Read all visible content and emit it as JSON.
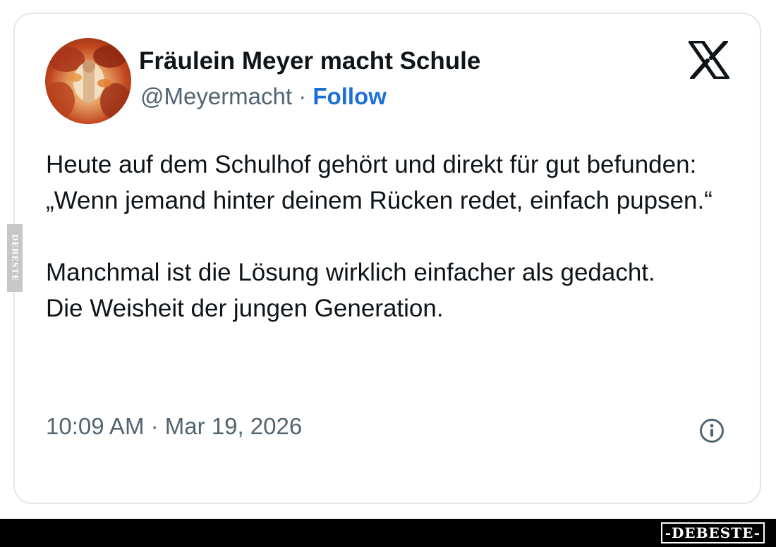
{
  "tweet": {
    "author": {
      "name": "Fräulein Meyer macht Schule",
      "handle": "@Meyermacht",
      "separator": " · ",
      "follow_label": "Follow",
      "avatar_icon": "avatar-photo-autumn-leaves"
    },
    "brand_icon": "x-logo-icon",
    "text_lines": [
      "Heute auf dem Schulhof gehört und direkt für gut befunden:",
      "„Wenn jemand hinter deinem Rücken redet, einfach pupsen.“",
      "",
      "Manchmal ist die Lösung wirklich einfacher als gedacht.",
      "Die Weisheit der jungen Generation."
    ],
    "timestamp": "10:09 AM · Mar 19, 2026",
    "info_icon": "info-icon"
  },
  "watermark": {
    "side": "DEBESTE",
    "bottom": "-DEBESTE-"
  },
  "colors": {
    "text": "#0f1419",
    "muted": "#536471",
    "link": "#1d6fd6",
    "border": "#e3e6ea"
  }
}
